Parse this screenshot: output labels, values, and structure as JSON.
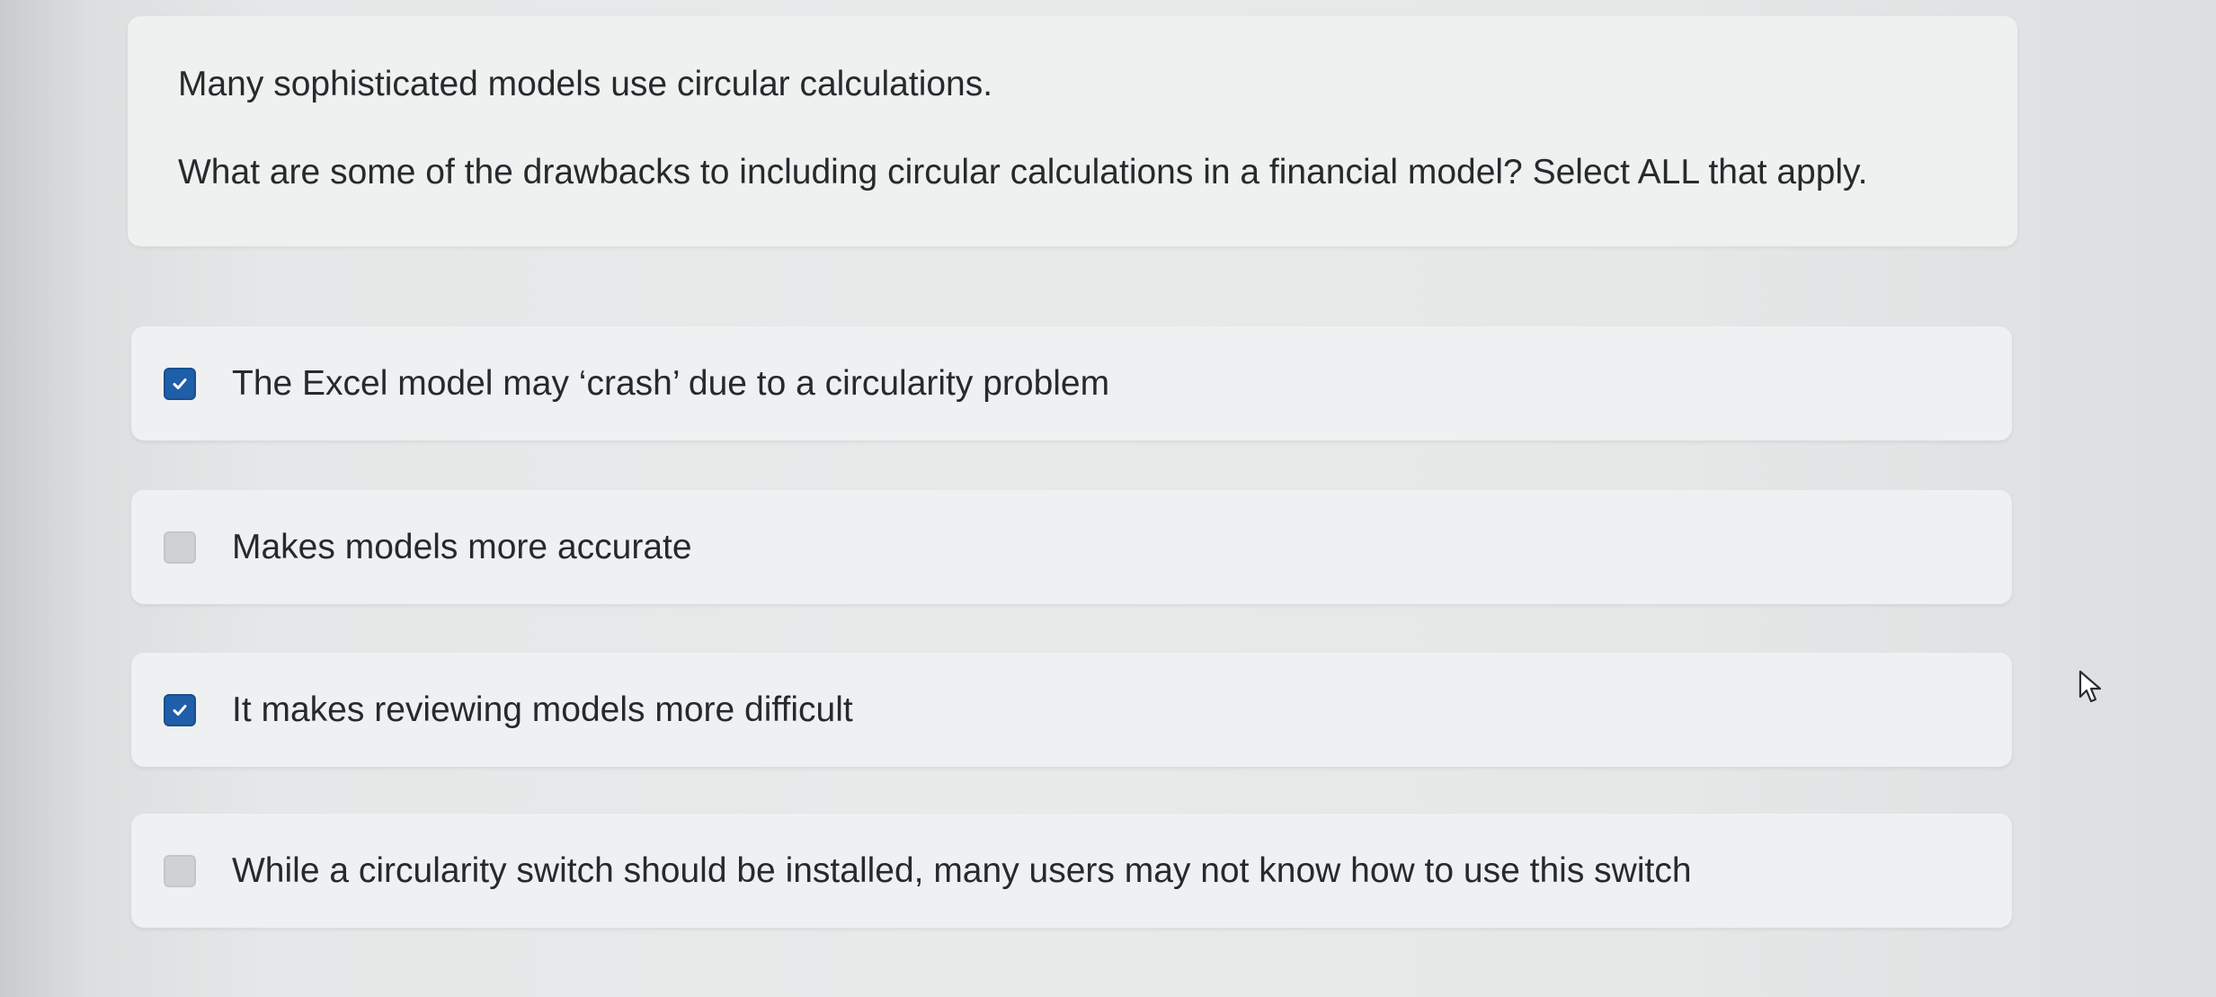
{
  "question": {
    "line1": "Many sophisticated models use circular calculations.",
    "line2": "What are some of the drawbacks to including circular calculations in a financial model? Select ALL that apply."
  },
  "options": [
    {
      "label": "The Excel model may ‘crash’ due to a circularity problem",
      "checked": true
    },
    {
      "label": "Makes models more accurate",
      "checked": false
    },
    {
      "label": "It makes reviewing models more difficult",
      "checked": true
    },
    {
      "label": "While a circularity switch should be installed, many users may not know how to use this switch",
      "checked": false
    }
  ],
  "colors": {
    "checkbox_checked": "#1f5ea8",
    "checkbox_unchecked": "#cfd2d4",
    "card_background": "#eff0f1"
  },
  "icons": {
    "check": "check-icon",
    "pointer": "mouse-pointer-icon"
  }
}
